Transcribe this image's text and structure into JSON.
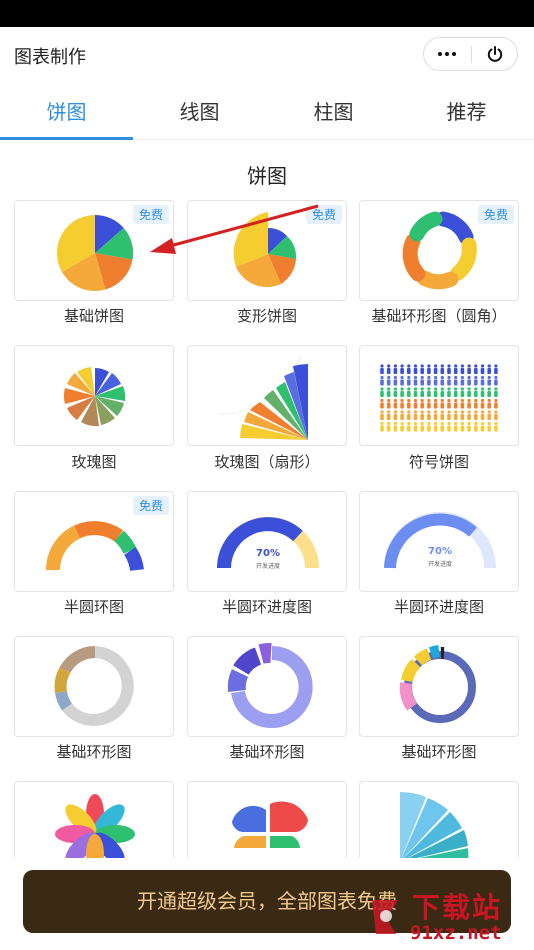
{
  "header": {
    "title": "图表制作"
  },
  "tabs": [
    {
      "label": "饼图",
      "active": true
    },
    {
      "label": "线图",
      "active": false
    },
    {
      "label": "柱图",
      "active": false
    },
    {
      "label": "推荐",
      "active": false
    }
  ],
  "section_title": "饼图",
  "badge_text": "免费",
  "cards": [
    {
      "label": "基础饼图",
      "badge": "免费"
    },
    {
      "label": "变形饼图",
      "badge": "免费"
    },
    {
      "label": "基础环形图（圆角）",
      "badge": "免费"
    },
    {
      "label": "玫瑰图",
      "badge": ""
    },
    {
      "label": "玫瑰图（扇形）",
      "badge": ""
    },
    {
      "label": "符号饼图",
      "badge": ""
    },
    {
      "label": "半圆环图",
      "badge": "免费"
    },
    {
      "label": "半圆环进度图",
      "badge": "",
      "value_text": "70%",
      "sub_text": "开发进度"
    },
    {
      "label": "半圆环进度图",
      "badge": "",
      "value_text": "70%",
      "sub_text": "开发进度"
    },
    {
      "label": "基础环形图",
      "badge": ""
    },
    {
      "label": "基础环形图",
      "badge": ""
    },
    {
      "label": "基础环形图",
      "badge": ""
    },
    {
      "label": "",
      "badge": ""
    },
    {
      "label": "",
      "badge": ""
    },
    {
      "label": "",
      "badge": ""
    }
  ],
  "vip_bar": {
    "text": "开通超级会员，全部图表免费"
  },
  "watermark": {
    "top": "下载站",
    "bottom": "91xz.net"
  },
  "icons": {
    "more": "more-dots-icon",
    "close": "power-icon"
  },
  "colors": {
    "accent": "#2f8fe0",
    "vip_bg": "#3a2a14",
    "vip_text": "#f1c98b",
    "watermark": "#c81623"
  }
}
